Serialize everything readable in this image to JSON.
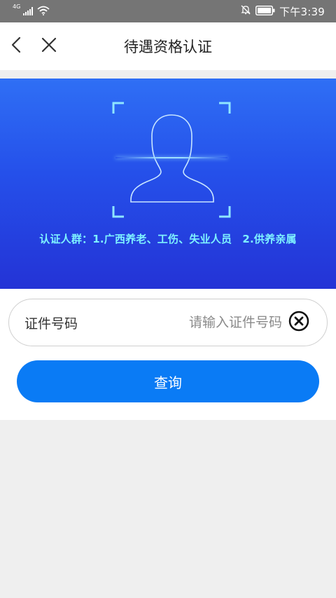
{
  "status_bar": {
    "network_label": "4G",
    "time": "下午3:39",
    "icons": [
      "signal-icon",
      "wifi-icon",
      "mute-bell-icon",
      "battery-icon"
    ]
  },
  "header": {
    "title": "待遇资格认证",
    "back_icon": "chevron-left-icon",
    "close_icon": "close-icon"
  },
  "banner": {
    "caption": "认证人群：1.广西养老、工伤、失业人员　2.供养亲属",
    "art_icon": "face-scan-icon"
  },
  "form": {
    "id_label": "证件号码",
    "id_placeholder": "请输入证件号码",
    "id_value": "",
    "clear_icon": "clear-circle-icon",
    "submit_label": "查询"
  },
  "colors": {
    "status_bar_bg": "#757575",
    "banner_top": "#2f6ff5",
    "banner_bottom": "#2433d6",
    "caption": "#7ef2ff",
    "primary_button": "#0a7bf5",
    "page_bg": "#efefef"
  }
}
